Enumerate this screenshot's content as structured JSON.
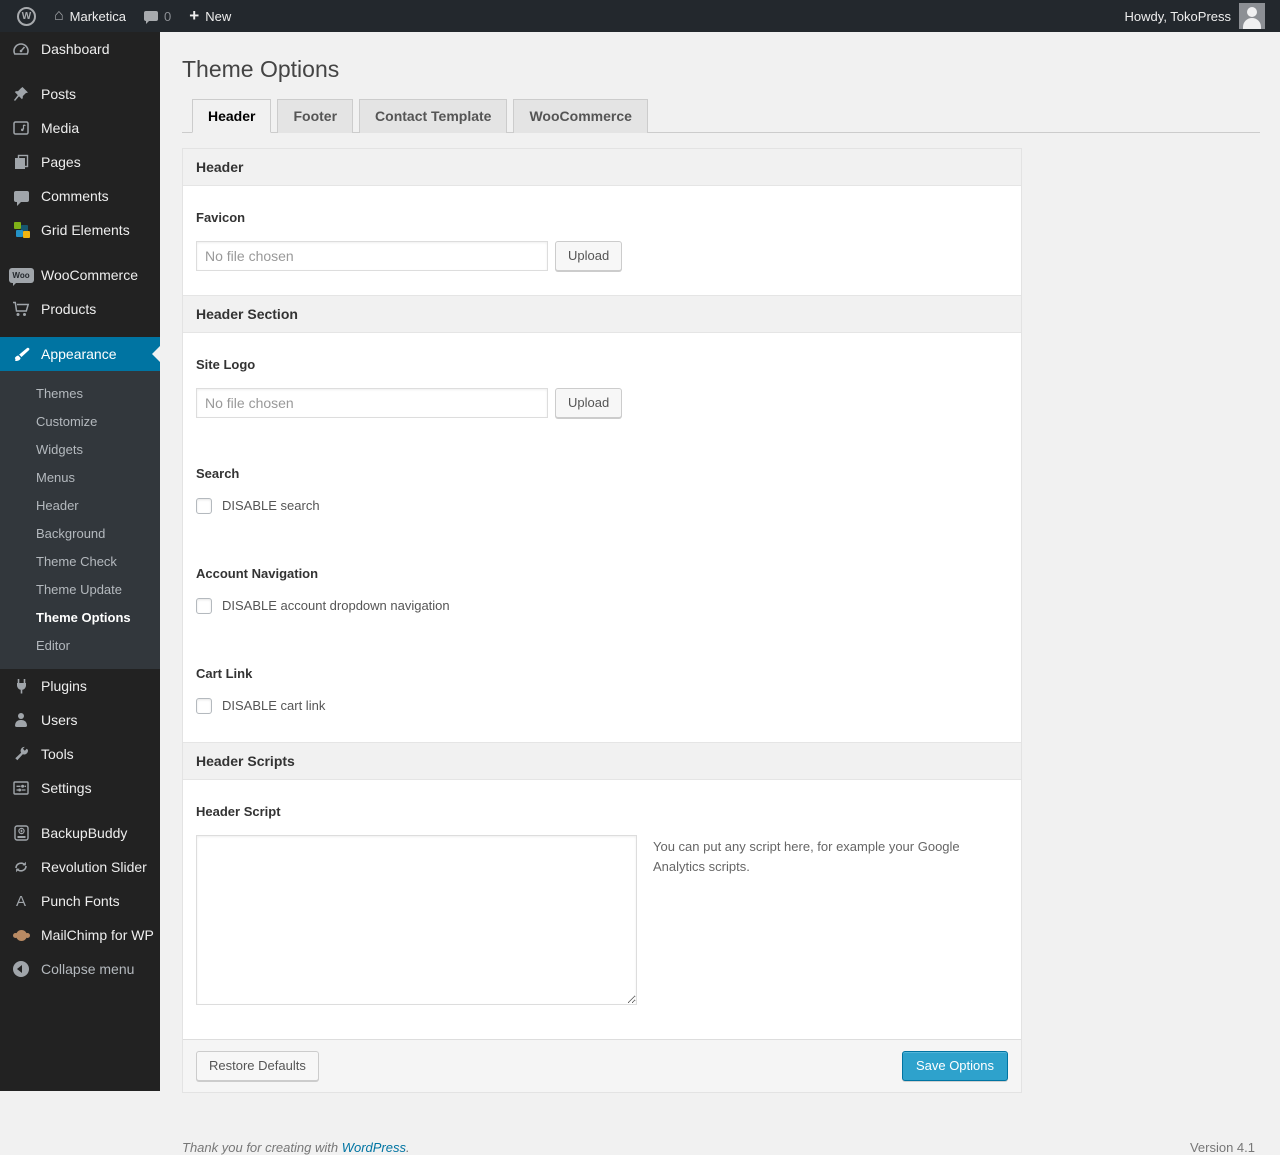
{
  "admin_bar": {
    "site_name": "Marketica",
    "comments_count": "0",
    "new_label": "New",
    "howdy_text": "Howdy, TokoPress"
  },
  "icons": {
    "wp_logo_letter": "W",
    "home_glyph": "⌂",
    "plus_glyph": "+",
    "woo_badge_text": "Woo",
    "punch_fonts_letter": "A"
  },
  "sidebar": {
    "items": [
      {
        "label": "Dashboard",
        "icon": "dashboard-icon"
      },
      {
        "label": "Posts",
        "icon": "pushpin-icon"
      },
      {
        "label": "Media",
        "icon": "media-icon"
      },
      {
        "label": "Pages",
        "icon": "pages-icon"
      },
      {
        "label": "Comments",
        "icon": "comment-icon"
      },
      {
        "label": "Grid Elements",
        "icon": "grid-elements-icon"
      },
      {
        "label": "WooCommerce",
        "icon": "woocommerce-badge-icon"
      },
      {
        "label": "Products",
        "icon": "cart-icon"
      },
      {
        "label": "Appearance",
        "icon": "brush-icon",
        "active": true
      },
      {
        "label": "Plugins",
        "icon": "plug-icon"
      },
      {
        "label": "Users",
        "icon": "user-icon"
      },
      {
        "label": "Tools",
        "icon": "wrench-icon"
      },
      {
        "label": "Settings",
        "icon": "sliders-icon"
      },
      {
        "label": "BackupBuddy",
        "icon": "backup-drive-icon"
      },
      {
        "label": "Revolution Slider",
        "icon": "rotate-arrows-icon"
      },
      {
        "label": "Punch Fonts",
        "icon": "letter-a-icon"
      },
      {
        "label": "MailChimp for WP",
        "icon": "monkey-icon"
      },
      {
        "label": "Collapse menu",
        "icon": "collapse-arrow-icon"
      }
    ],
    "appearance_submenu": [
      {
        "label": "Themes"
      },
      {
        "label": "Customize"
      },
      {
        "label": "Widgets"
      },
      {
        "label": "Menus"
      },
      {
        "label": "Header"
      },
      {
        "label": "Background"
      },
      {
        "label": "Theme Check"
      },
      {
        "label": "Theme Update"
      },
      {
        "label": "Theme Options",
        "current": true
      },
      {
        "label": "Editor"
      }
    ]
  },
  "page": {
    "title": "Theme Options",
    "tabs": [
      {
        "label": "Header",
        "active": true
      },
      {
        "label": "Footer"
      },
      {
        "label": "Contact Template"
      },
      {
        "label": "WooCommerce"
      }
    ]
  },
  "form": {
    "section_header": "Header",
    "favicon_label": "Favicon",
    "favicon_placeholder": "No file chosen",
    "favicon_upload": "Upload",
    "section_header_section": "Header Section",
    "site_logo_label": "Site Logo",
    "site_logo_placeholder": "No file chosen",
    "site_logo_upload": "Upload",
    "search_label": "Search",
    "search_checkbox": "DISABLE search",
    "account_label": "Account Navigation",
    "account_checkbox": "DISABLE account dropdown navigation",
    "cart_label": "Cart Link",
    "cart_checkbox": "DISABLE cart link",
    "section_scripts": "Header Scripts",
    "script_label": "Header Script",
    "script_help": "You can put any script here, for example your Google Analytics scripts.",
    "restore_button": "Restore Defaults",
    "save_button": "Save Options"
  },
  "footer": {
    "thanks_text": "Thank you for creating with",
    "wordpress_link": "WordPress",
    "period": ".",
    "version": "Version 4.1"
  },
  "colors": {
    "accent_blue": "#0074a2",
    "primary_button_blue": "#2ea2cc",
    "admin_bar_bg": "#23282d",
    "menu_bg": "#222222",
    "submenu_bg": "#32373c",
    "page_bg": "#f1f1f1"
  }
}
